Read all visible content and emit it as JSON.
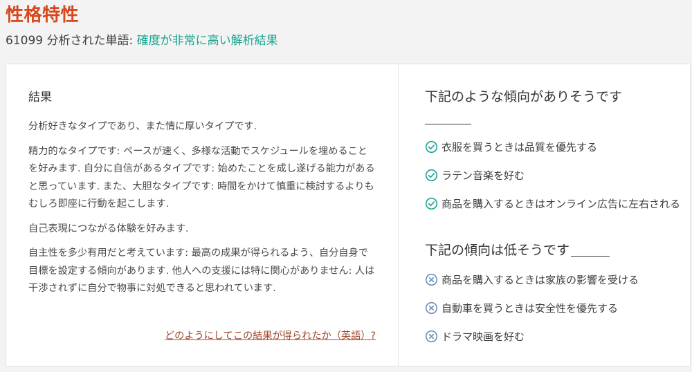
{
  "header": {
    "title": "性格特性",
    "word_count": "61099",
    "subtitle_text": " 分析された単語: ",
    "confidence": "確度が非常に高い解析結果"
  },
  "result": {
    "heading": "結果",
    "paragraphs": [
      "分析好きなタイプであり、また情に厚いタイプです.",
      "精力的なタイプです: ペースが速く、多様な活動でスケジュールを埋めることを好みます. 自分に自信があるタイプです: 始めたことを成し遂げる能力があると思っています. また、大胆なタイプです: 時間をかけて慎重に検討するよりもむしろ即座に行動を起こします.",
      "自己表現につながる体験を好みます.",
      "自主性を多少有用だと考えています: 最高の成果が得られるよう、自分自身で目標を設定する傾向があります. 他人への支援には特に関心がありません: 人は干渉されずに自分で物事に対処できると思われています."
    ],
    "how_link": "どのようにしてこの結果が得られたか（英語）?"
  },
  "likely": {
    "heading": "下記のような傾向がありそうです",
    "items": [
      "衣服を買うときは品質を優先する",
      "ラテン音楽を好む",
      "商品を購入するときはオンライン広告に左右される"
    ]
  },
  "unlikely": {
    "heading": "下記の傾向は低そうです",
    "items": [
      "商品を購入するときは家族の影響を受ける",
      "自動車を買うときは安全性を優先する",
      "ドラマ映画を好む"
    ]
  },
  "colors": {
    "title": "#d9471c",
    "accent": "#1aa592",
    "check_icon": "#1aa592",
    "cross_icon": "#6f8fb8",
    "link": "#a0472c"
  },
  "icons": {
    "likely": "check-circle-icon",
    "unlikely": "x-circle-icon"
  }
}
